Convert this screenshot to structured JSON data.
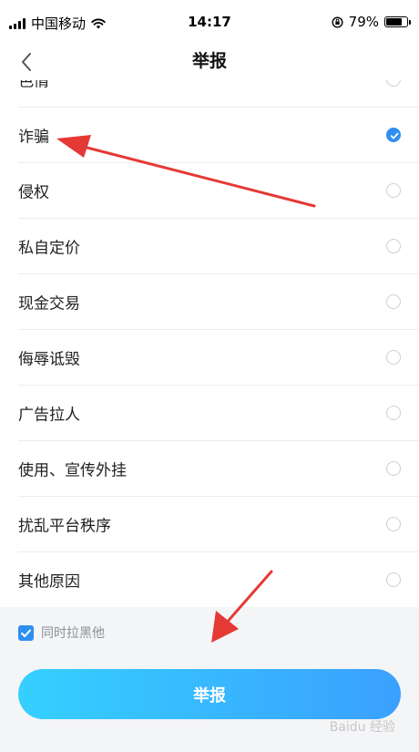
{
  "status_bar": {
    "carrier": "中国移动",
    "time": "14:17",
    "battery": "79%",
    "battery_level": 0.79
  },
  "nav": {
    "title": "举报"
  },
  "reasons": [
    {
      "label": "色情",
      "checked": false
    },
    {
      "label": "诈骗",
      "checked": true
    },
    {
      "label": "侵权",
      "checked": false
    },
    {
      "label": "私自定价",
      "checked": false
    },
    {
      "label": "现金交易",
      "checked": false
    },
    {
      "label": "侮辱诋毁",
      "checked": false
    },
    {
      "label": "广告拉人",
      "checked": false
    },
    {
      "label": "使用、宣传外挂",
      "checked": false
    },
    {
      "label": "扰乱平台秩序",
      "checked": false
    },
    {
      "label": "其他原因",
      "checked": false
    }
  ],
  "block_option": {
    "label": "同时拉黑他",
    "checked": true
  },
  "submit": {
    "label": "举报"
  },
  "watermark": "Baidu 经验",
  "colors": {
    "accent": "#2e8ff0",
    "annotation_arrow": "#e53935"
  }
}
